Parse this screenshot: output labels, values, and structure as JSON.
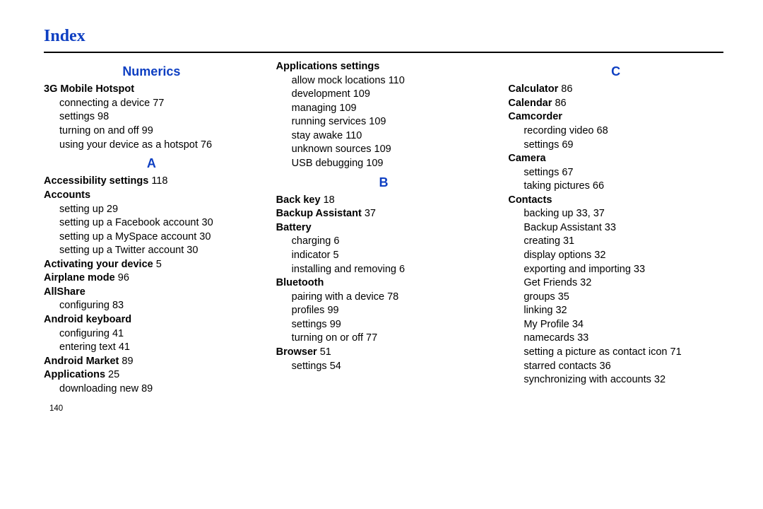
{
  "page_number": "140",
  "title": "Index",
  "columns": [
    [
      {
        "type": "letter",
        "text": "Numerics"
      },
      {
        "type": "bold",
        "text": "3G Mobile Hotspot"
      },
      {
        "type": "sub",
        "text": "connecting a device",
        "page": "77"
      },
      {
        "type": "sub",
        "text": "settings",
        "page": "98"
      },
      {
        "type": "sub",
        "text": "turning on and off",
        "page": "99"
      },
      {
        "type": "sub",
        "text": "using your device as a hotspot",
        "page": "76"
      },
      {
        "type": "letter",
        "text": "A"
      },
      {
        "type": "bold",
        "text": "Accessibility settings",
        "page": "118"
      },
      {
        "type": "bold",
        "text": "Accounts"
      },
      {
        "type": "sub",
        "text": "setting up",
        "page": "29"
      },
      {
        "type": "sub",
        "text": "setting up a Facebook account",
        "page": "30"
      },
      {
        "type": "sub",
        "text": "setting up a MySpace account",
        "page": "30"
      },
      {
        "type": "sub",
        "text": "setting up a Twitter account",
        "page": "30"
      },
      {
        "type": "bold",
        "text": "Activating your device",
        "page": "5"
      },
      {
        "type": "bold",
        "text": "Airplane mode",
        "page": "96"
      },
      {
        "type": "bold",
        "text": "AllShare"
      },
      {
        "type": "sub",
        "text": "configuring",
        "page": "83"
      },
      {
        "type": "bold",
        "text": "Android keyboard"
      },
      {
        "type": "sub",
        "text": "configuring",
        "page": "41"
      },
      {
        "type": "sub",
        "text": "entering text",
        "page": "41"
      },
      {
        "type": "bold",
        "text": "Android Market",
        "page": "89"
      },
      {
        "type": "bold",
        "text": "Applications",
        "page": "25"
      },
      {
        "type": "sub",
        "text": "downloading new",
        "page": "89"
      }
    ],
    [
      {
        "type": "bold",
        "text": "Applications settings"
      },
      {
        "type": "sub",
        "text": "allow mock locations",
        "page": "110"
      },
      {
        "type": "sub",
        "text": "development",
        "page": "109"
      },
      {
        "type": "sub",
        "text": "managing",
        "page": "109"
      },
      {
        "type": "sub",
        "text": "running services",
        "page": "109"
      },
      {
        "type": "sub",
        "text": "stay awake",
        "page": "110"
      },
      {
        "type": "sub",
        "text": "unknown sources",
        "page": "109"
      },
      {
        "type": "sub",
        "text": "USB debugging",
        "page": "109"
      },
      {
        "type": "letter",
        "text": "B"
      },
      {
        "type": "bold",
        "text": "Back key",
        "page": "18"
      },
      {
        "type": "bold",
        "text": "Backup Assistant",
        "page": "37"
      },
      {
        "type": "bold",
        "text": "Battery"
      },
      {
        "type": "sub",
        "text": "charging",
        "page": "6"
      },
      {
        "type": "sub",
        "text": "indicator",
        "page": "5"
      },
      {
        "type": "sub",
        "text": "installing and removing",
        "page": "6"
      },
      {
        "type": "bold",
        "text": "Bluetooth"
      },
      {
        "type": "sub",
        "text": "pairing with a device",
        "page": "78"
      },
      {
        "type": "sub",
        "text": "profiles",
        "page": "99"
      },
      {
        "type": "sub",
        "text": "settings",
        "page": "99"
      },
      {
        "type": "sub",
        "text": "turning on or off",
        "page": "77"
      },
      {
        "type": "bold",
        "text": "Browser",
        "page": "51"
      },
      {
        "type": "sub",
        "text": "settings",
        "page": "54"
      }
    ],
    [
      {
        "type": "letter",
        "text": "C"
      },
      {
        "type": "bold",
        "text": "Calculator",
        "page": "86"
      },
      {
        "type": "bold",
        "text": "Calendar",
        "page": "86"
      },
      {
        "type": "bold",
        "text": "Camcorder"
      },
      {
        "type": "sub",
        "text": "recording video",
        "page": "68"
      },
      {
        "type": "sub",
        "text": "settings",
        "page": "69"
      },
      {
        "type": "bold",
        "text": "Camera"
      },
      {
        "type": "sub",
        "text": "settings",
        "page": "67"
      },
      {
        "type": "sub",
        "text": "taking pictures",
        "page": "66"
      },
      {
        "type": "bold",
        "text": "Contacts"
      },
      {
        "type": "sub",
        "text": "backing up",
        "page": "33, 37"
      },
      {
        "type": "sub",
        "text": "Backup Assistant",
        "page": "33"
      },
      {
        "type": "sub",
        "text": "creating",
        "page": "31"
      },
      {
        "type": "sub",
        "text": "display options",
        "page": "32"
      },
      {
        "type": "sub",
        "text": "exporting and importing",
        "page": "33"
      },
      {
        "type": "sub",
        "text": "Get Friends",
        "page": "32"
      },
      {
        "type": "sub",
        "text": "groups",
        "page": "35"
      },
      {
        "type": "sub",
        "text": "linking",
        "page": "32"
      },
      {
        "type": "sub",
        "text": "My Profile",
        "page": "34"
      },
      {
        "type": "sub",
        "text": "namecards",
        "page": "33"
      },
      {
        "type": "sub",
        "text": "setting a picture as contact icon",
        "page": "71"
      },
      {
        "type": "sub",
        "text": "starred contacts",
        "page": "36"
      },
      {
        "type": "sub",
        "text": "synchronizing with accounts",
        "page": "32"
      }
    ]
  ]
}
